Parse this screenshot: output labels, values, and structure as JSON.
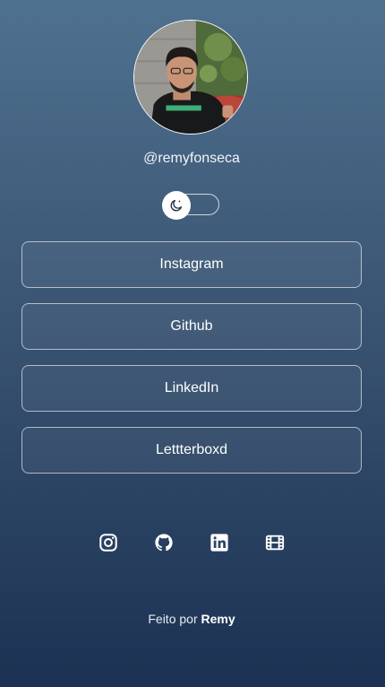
{
  "profile": {
    "username": "@remyfonseca"
  },
  "theme_toggle": {
    "icon": "moon-icon"
  },
  "links": [
    {
      "label": "Instagram"
    },
    {
      "label": "Github"
    },
    {
      "label": "LinkedIn"
    },
    {
      "label": "Lettterboxd"
    }
  ],
  "social_icons": [
    "instagram-icon",
    "github-icon",
    "linkedin-icon",
    "film-icon"
  ],
  "footer": {
    "prefix": "Feito por",
    "author": "Remy"
  },
  "colors": {
    "background_top": "#4f7190",
    "background_bottom": "#1c3153",
    "text": "#ffffff"
  }
}
